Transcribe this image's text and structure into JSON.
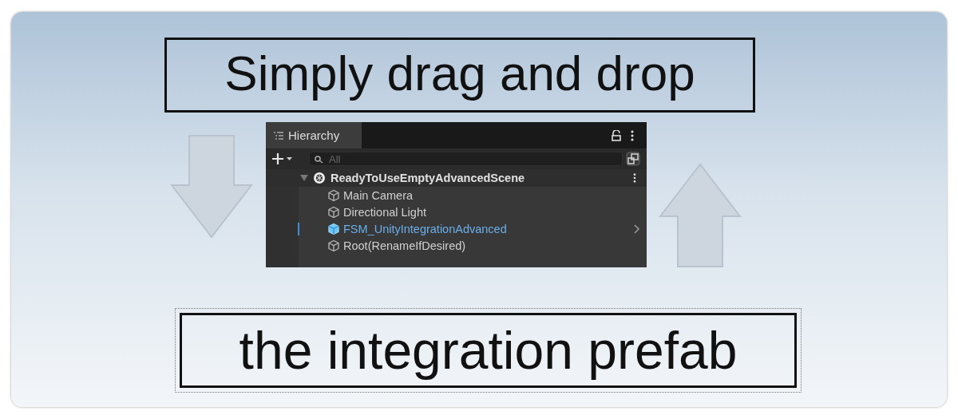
{
  "slide": {
    "heading": "Simply drag and drop",
    "caption": "the integration prefab"
  },
  "hierarchy": {
    "tab": {
      "label": "Hierarchy",
      "selected": true
    },
    "search": {
      "placeholder": "All"
    },
    "scene": {
      "name": "ReadyToUseEmptyAdvancedScene",
      "expanded": true,
      "children": [
        {
          "name": "Main Camera",
          "kind": "object",
          "selected": false
        },
        {
          "name": "Directional Light",
          "kind": "object",
          "selected": false
        },
        {
          "name": "FSM_UnityIntegrationAdvanced",
          "kind": "prefab",
          "selected": true
        },
        {
          "name": "Root(RenameIfDesired)",
          "kind": "object",
          "selected": false
        }
      ]
    }
  }
}
